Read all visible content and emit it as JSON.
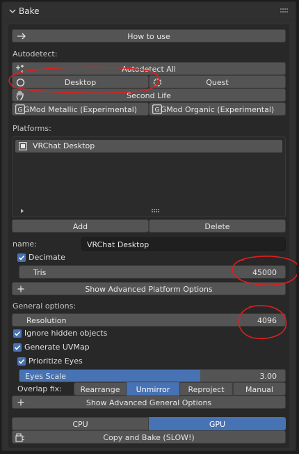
{
  "panel": {
    "title": "Bake"
  },
  "how_to_use": "How to use",
  "autodetect": {
    "label": "Autodetect:",
    "all": "Autodetect All",
    "desktop": "Desktop",
    "quest": "Quest",
    "second_life": "Second Life",
    "gmod_metallic": "GMod Metallic (Experimental)",
    "gmod_organic": "GMod Organic (Experimental)"
  },
  "platforms": {
    "label": "Platforms:",
    "items": [
      "VRChat Desktop"
    ],
    "add": "Add",
    "delete": "Delete"
  },
  "platform": {
    "name_label": "name:",
    "name_value": "VRChat Desktop",
    "decimate_label": "Decimate",
    "decimate_checked": true,
    "tris_label": "Tris",
    "tris_value": "45000",
    "advanced": "Show Advanced Platform Options"
  },
  "general": {
    "label": "General options:",
    "resolution_label": "Resolution",
    "resolution_value": "4096",
    "ignore_hidden": "Ignore hidden objects",
    "generate_uvmap": "Generate UVMap",
    "prioritize_eyes": "Prioritize Eyes",
    "eyes_scale_label": "Eyes Scale",
    "eyes_scale_value": "3.00",
    "eyes_scale_fraction": 0.68,
    "overlap_label": "Overlap fix:",
    "overlap_options": [
      "Rearrange",
      "Unmirror",
      "Reproject",
      "Manual"
    ],
    "overlap_selected": "Unmirror",
    "advanced": "Show Advanced General Options"
  },
  "device": {
    "options": [
      "CPU",
      "GPU"
    ],
    "selected": "GPU"
  },
  "bake_button": "Copy and Bake (SLOW!)",
  "colors": {
    "accent": "#4772b3",
    "annotation": "#e01e1e",
    "button": "#545454",
    "background": "#303030"
  }
}
